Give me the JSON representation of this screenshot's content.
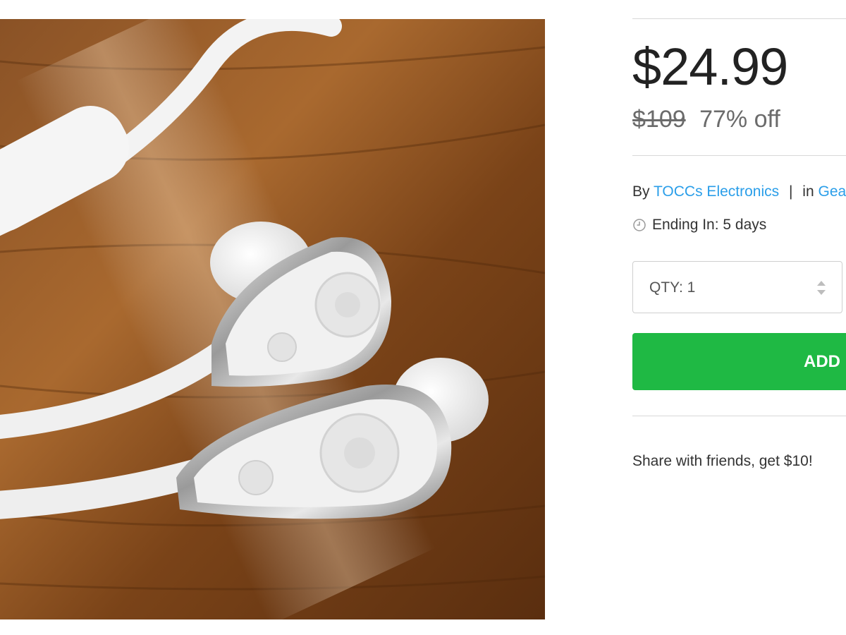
{
  "product": {
    "image_alt": "White in-ear headphones on wooden table"
  },
  "pricing": {
    "price": "$24.99",
    "original_price": "$109",
    "discount": "77% off"
  },
  "seller": {
    "by_label": "By",
    "vendor": "TOCCs Electronics",
    "separator": "|",
    "in_label": "in",
    "category": "Gea"
  },
  "timer": {
    "icon": "clock-icon",
    "text": "Ending In: 5 days"
  },
  "quantity": {
    "label": "QTY: 1",
    "icon": "up-down-stepper-icon"
  },
  "cart": {
    "button_label": "ADD",
    "color": "#1fb944"
  },
  "share": {
    "text": "Share with friends, get $10!"
  },
  "colors": {
    "link": "#2a9ee9",
    "button": "#1fb944",
    "price": "#222222"
  }
}
